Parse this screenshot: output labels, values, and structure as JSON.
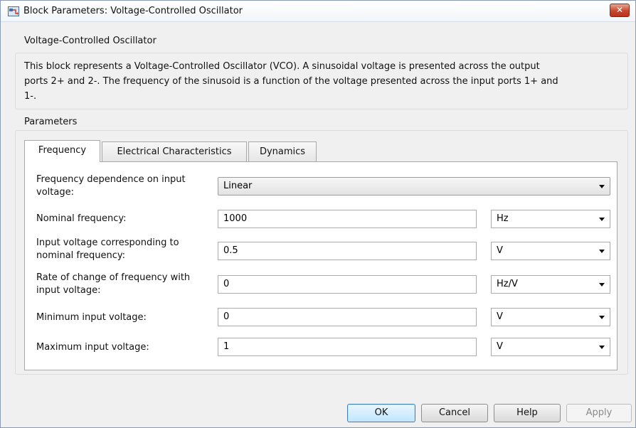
{
  "window": {
    "title": "Block Parameters: Voltage-Controlled Oscillator",
    "close_label": "✕"
  },
  "description_group": {
    "title": "Voltage-Controlled Oscillator",
    "lines": [
      "This block represents a Voltage-Controlled Oscillator (VCO). A sinusoidal voltage is presented across the output",
      "ports 2+ and 2-. The frequency of the sinusoid is a function of the voltage presented across the input ports 1+ and",
      "1-."
    ]
  },
  "parameters_group": {
    "title": "Parameters"
  },
  "tabs": [
    {
      "label": "Frequency",
      "active": true
    },
    {
      "label": "Electrical Characteristics",
      "active": false
    },
    {
      "label": "Dynamics",
      "active": false
    }
  ],
  "params": {
    "freq_dependence": {
      "label_line1": "Frequency dependence on input",
      "label_line2": "voltage:",
      "value": "Linear"
    },
    "nominal_frequency": {
      "label": "Nominal frequency:",
      "value": "1000",
      "unit": "Hz"
    },
    "input_voltage_nominal": {
      "label_line1": "Input voltage corresponding to",
      "label_line2": "nominal frequency:",
      "value": "0.5",
      "unit": "V"
    },
    "rate_of_change": {
      "label_line1": "Rate of change of frequency with",
      "label_line2": "input voltage:",
      "value": "0",
      "unit": "Hz/V"
    },
    "min_input_voltage": {
      "label": "Minimum input voltage:",
      "value": "0",
      "unit": "V"
    },
    "max_input_voltage": {
      "label": "Maximum input voltage:",
      "value": "1",
      "unit": "V"
    }
  },
  "buttons": {
    "ok": "OK",
    "cancel": "Cancel",
    "help": "Help",
    "apply": "Apply"
  }
}
